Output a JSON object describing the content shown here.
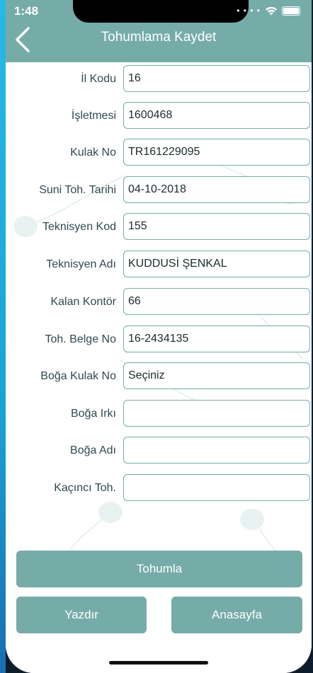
{
  "status": {
    "time": "1:48",
    "icons": [
      "dots-icon",
      "wifi-icon",
      "battery-icon"
    ]
  },
  "nav": {
    "title": "Tohumlama Kaydet",
    "back_icon": "chevron-left-icon"
  },
  "form": {
    "fields": [
      {
        "label": "İl Kodu",
        "value": "16"
      },
      {
        "label": "İşletmesi",
        "value": "1600468"
      },
      {
        "label": "Kulak No",
        "value": "TR161229095"
      },
      {
        "label": "Suni Toh. Tarihi",
        "value": "04-10-2018"
      },
      {
        "label": "Teknisyen Kod",
        "value": "155"
      },
      {
        "label": "Teknisyen Adı",
        "value": "KUDDUSİ ŞENKAL"
      },
      {
        "label": "Kalan Kontör",
        "value": "66"
      },
      {
        "label": "Toh. Belge No",
        "value": "16-2434135"
      },
      {
        "label": "Boğa Kulak No",
        "value": "Seçiniz"
      },
      {
        "label": "Boğa Irkı",
        "value": ""
      },
      {
        "label": "Boğa Adı",
        "value": ""
      },
      {
        "label": "Kaçıncı Toh.",
        "value": ""
      }
    ]
  },
  "buttons": {
    "submit": "Tohumla",
    "print": "Yazdır",
    "home": "Anasayfa"
  },
  "colors": {
    "accent": "#76aca8",
    "text": "#2e4a51",
    "border": "#76aca8"
  }
}
